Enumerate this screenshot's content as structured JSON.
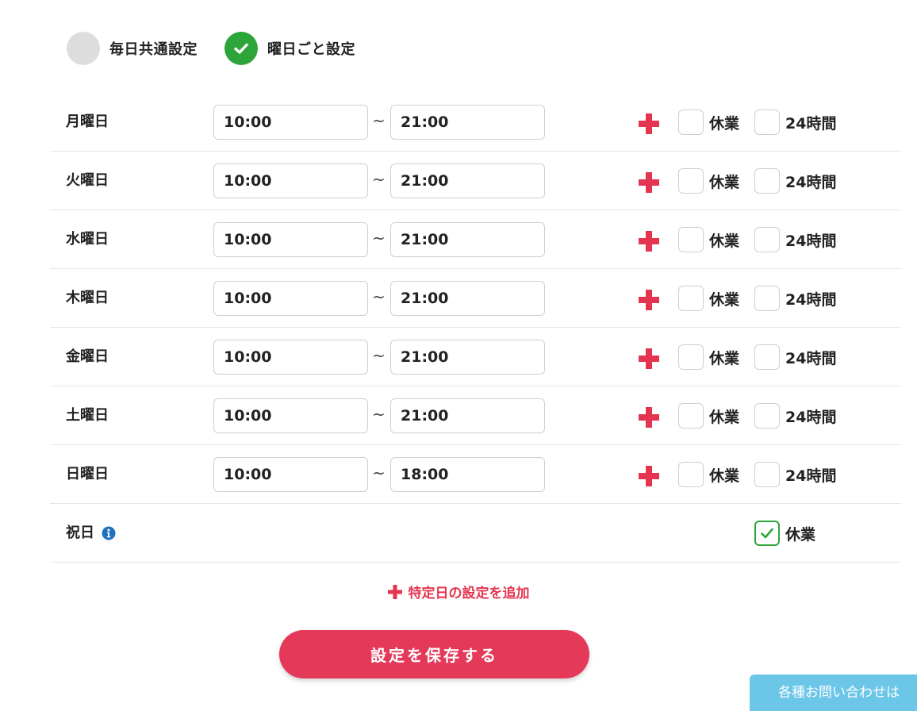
{
  "mode": {
    "options": [
      {
        "label": "毎日共通設定",
        "checked": false
      },
      {
        "label": "曜日ごと設定",
        "checked": true
      }
    ]
  },
  "days": [
    {
      "label": "月曜日",
      "start": "10:00",
      "end": "21:00",
      "holiday": false,
      "all_day": false
    },
    {
      "label": "火曜日",
      "start": "10:00",
      "end": "21:00",
      "holiday": false,
      "all_day": false
    },
    {
      "label": "水曜日",
      "start": "10:00",
      "end": "21:00",
      "holiday": false,
      "all_day": false
    },
    {
      "label": "木曜日",
      "start": "10:00",
      "end": "21:00",
      "holiday": false,
      "all_day": false
    },
    {
      "label": "金曜日",
      "start": "10:00",
      "end": "21:00",
      "holiday": false,
      "all_day": false
    },
    {
      "label": "土曜日",
      "start": "10:00",
      "end": "21:00",
      "holiday": false,
      "all_day": false
    },
    {
      "label": "日曜日",
      "start": "10:00",
      "end": "18:00",
      "holiday": false,
      "all_day": false
    }
  ],
  "labels": {
    "separator": "~",
    "holiday": "休業",
    "all_day": "24時間"
  },
  "public_holiday": {
    "label": "祝日",
    "holiday_label": "休業",
    "holiday_checked": true
  },
  "add_special_date": "特定日の設定を追加",
  "save_button": "設定を保存する",
  "contact_tab": "各種お問い合わせは",
  "colors": {
    "accent_red": "#e5395a",
    "check_green": "#2ea53a",
    "info_blue": "#1e73be",
    "contact_blue": "#6cc6e8"
  },
  "icons": {
    "mode_check": "check-circle-icon",
    "add_slot": "plus-icon",
    "info": "info-circle-icon"
  }
}
